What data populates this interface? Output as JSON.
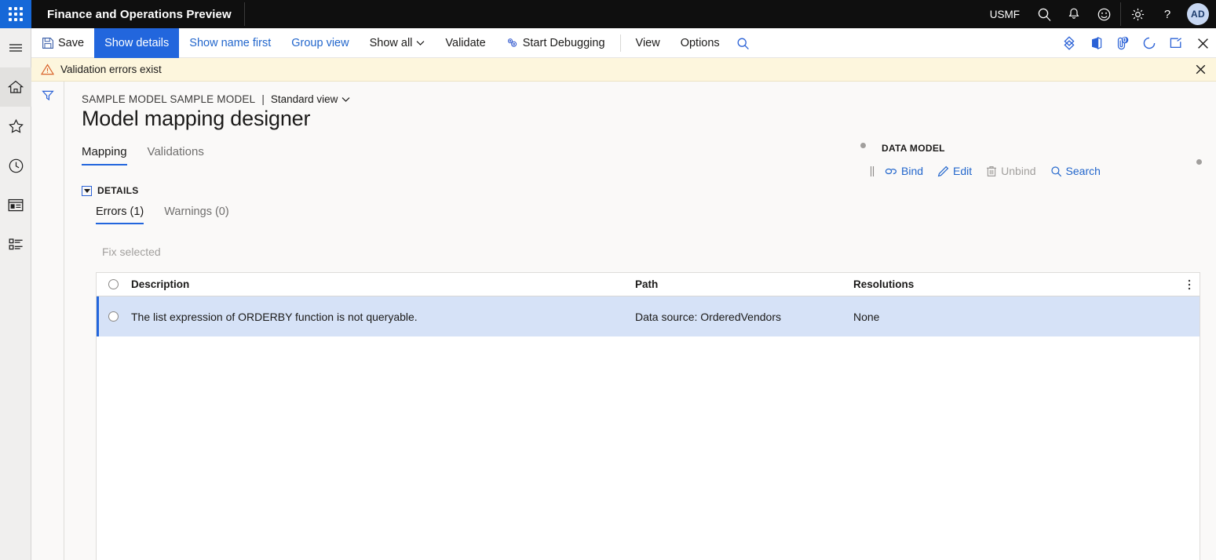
{
  "topbar": {
    "waffle_name": "app-launcher",
    "app_title": "Finance and Operations Preview",
    "company": "USMF",
    "icons": [
      "search-icon",
      "notifications-bell-icon",
      "feedback-smiley-icon",
      "settings-gear-icon",
      "help-question-icon"
    ],
    "avatar_initials": "AD"
  },
  "rail": {
    "items": [
      {
        "name": "hamburger-menu-icon",
        "label": "Expand the navigation pane"
      },
      {
        "name": "home-icon",
        "label": "Home"
      },
      {
        "name": "star-favorites-icon",
        "label": "Favorites"
      },
      {
        "name": "clock-recent-icon",
        "label": "Recent"
      },
      {
        "name": "workspaces-icon",
        "label": "Workspaces"
      },
      {
        "name": "modules-list-icon",
        "label": "Modules"
      }
    ]
  },
  "commandbar": {
    "save_label": "Save",
    "show_details_label": "Show details",
    "show_name_first_label": "Show name first",
    "group_view_label": "Group view",
    "show_all_label": "Show all",
    "validate_label": "Validate",
    "start_debugging_label": "Start Debugging",
    "view_label": "View",
    "options_label": "Options",
    "search_icon": "search-icon",
    "right_icons": [
      {
        "name": "powerapps-icon"
      },
      {
        "name": "office-icon"
      },
      {
        "name": "attachments-icon",
        "badge": "0"
      },
      {
        "name": "refresh-icon"
      },
      {
        "name": "open-in-new-window-icon"
      },
      {
        "name": "close-page-icon"
      }
    ]
  },
  "messagebar": {
    "icon": "warning-triangle-icon",
    "text": "Validation errors exist",
    "close_icon": "close-icon"
  },
  "filterstrip": {
    "icon": "filter-funnel-icon"
  },
  "page": {
    "breadcrumb_model": "SAMPLE MODEL SAMPLE MODEL",
    "breadcrumb_separator": "|",
    "breadcrumb_view": "Standard view",
    "title": "Model mapping designer"
  },
  "pivot": {
    "tabs": [
      {
        "label": "Mapping",
        "active": true
      },
      {
        "label": "Validations",
        "active": false
      }
    ]
  },
  "details": {
    "group_label": "DETAILS",
    "subtabs": [
      {
        "label": "Errors (1)",
        "active": true
      },
      {
        "label": "Warnings (0)",
        "active": false
      }
    ],
    "fix_selected_label": "Fix selected"
  },
  "grid": {
    "columns": [
      "Description",
      "Path",
      "Resolutions"
    ],
    "overflow_menu_icon": "column-options-icon",
    "header_select_all": "select-all-radio",
    "rows": [
      {
        "description": "The list expression of ORDERBY function is not queryable.",
        "path": "Data source: OrderedVendors",
        "resolutions": "None",
        "selected": true
      }
    ]
  },
  "datamodel": {
    "title": "DATA MODEL",
    "buttons": [
      {
        "label": "Bind",
        "icon": "bind-link-icon",
        "disabled": false
      },
      {
        "label": "Edit",
        "icon": "edit-pencil-icon",
        "disabled": false
      },
      {
        "label": "Unbind",
        "icon": "unbind-trash-icon",
        "disabled": true
      },
      {
        "label": "Search",
        "icon": "search-icon",
        "disabled": false
      }
    ]
  },
  "colors": {
    "accent": "#2266dd",
    "link": "#2266cc",
    "topbar_bg": "#0f0f0f",
    "waffle_bg": "#1668d8",
    "warning_bar_bg": "#fdf6dd",
    "row_selected_bg": "#d6e2f7",
    "canvas_bg": "#faf9f8"
  }
}
